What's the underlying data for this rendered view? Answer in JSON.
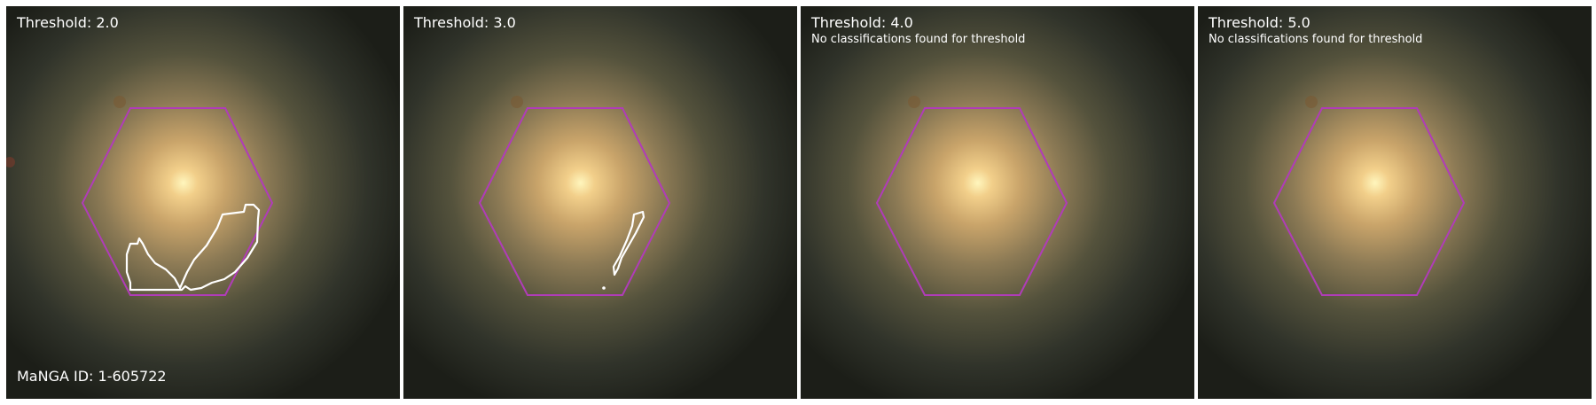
{
  "panels": [
    {
      "title": "Threshold: 2.0",
      "note": ""
    },
    {
      "title": "Threshold: 3.0",
      "note": ""
    },
    {
      "title": "Threshold: 4.0",
      "note": "No classifications found for threshold"
    },
    {
      "title": "Threshold: 5.0",
      "note": "No classifications found for threshold"
    }
  ],
  "manga_id": "MaNGA ID: 1-605722",
  "colors": {
    "hexagon": "#b03cb8",
    "contour": "#ffffff",
    "galaxy_core": "#fff2b0",
    "background": "#1c1e18"
  }
}
